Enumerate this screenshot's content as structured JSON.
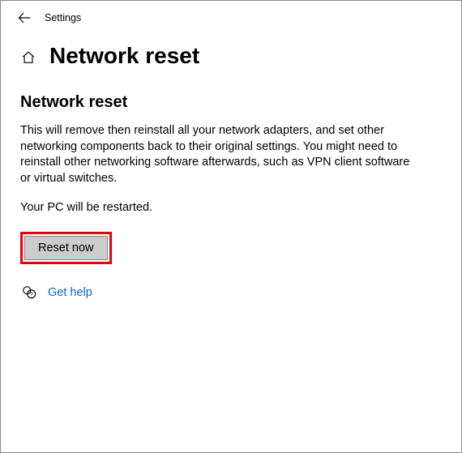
{
  "titlebar": {
    "app_title": "Settings"
  },
  "header": {
    "page_title": "Network reset"
  },
  "content": {
    "section_title": "Network reset",
    "description": "This will remove then reinstall all your network adapters, and set other networking components back to their original settings. You might need to reinstall other networking software afterwards, such as VPN client software or virtual switches.",
    "restart_note": "Your PC will be restarted.",
    "reset_button_label": "Reset now",
    "help_link_label": "Get help"
  }
}
